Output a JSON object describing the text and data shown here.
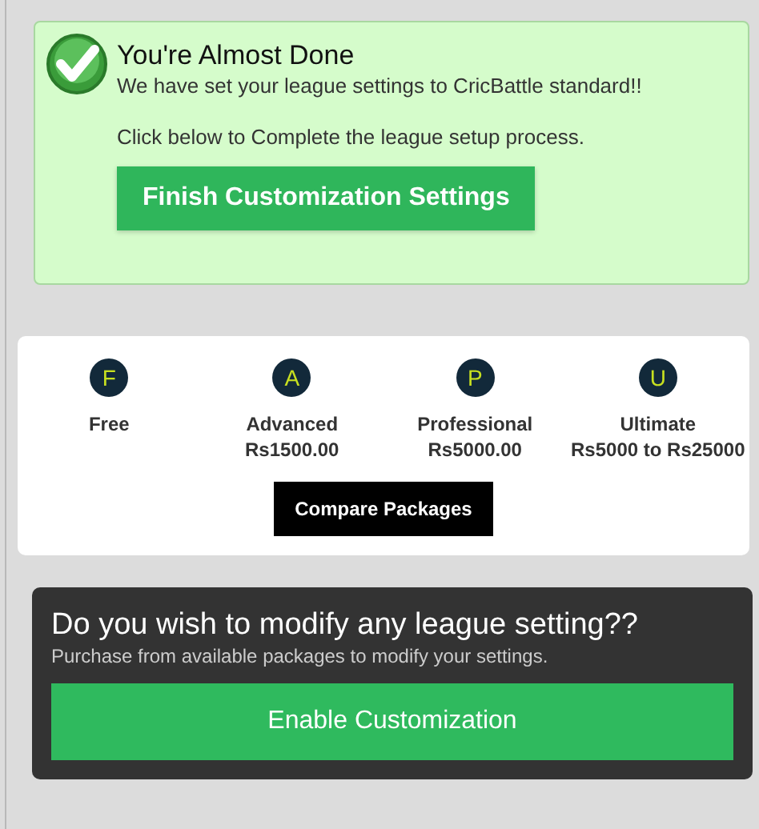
{
  "notice": {
    "title": "You're Almost Done",
    "message": "We have set your league settings to CricBattle standard!!",
    "instruction": "Click below to Complete the league setup process.",
    "button": "Finish Customization Settings"
  },
  "packages": [
    {
      "letter": "F",
      "name": "Free"
    },
    {
      "letter": "A",
      "name": "Advanced",
      "price": "Rs1500.00"
    },
    {
      "letter": "P",
      "name": "Professional",
      "price": "Rs5000.00"
    },
    {
      "letter": "U",
      "name": "Ultimate",
      "price": "Rs5000 to Rs25000"
    }
  ],
  "compare_button": "Compare Packages",
  "customize": {
    "title": "Do you wish to modify any league setting??",
    "subtitle": "Purchase from available packages to modify your settings.",
    "button": "Enable Customization"
  }
}
